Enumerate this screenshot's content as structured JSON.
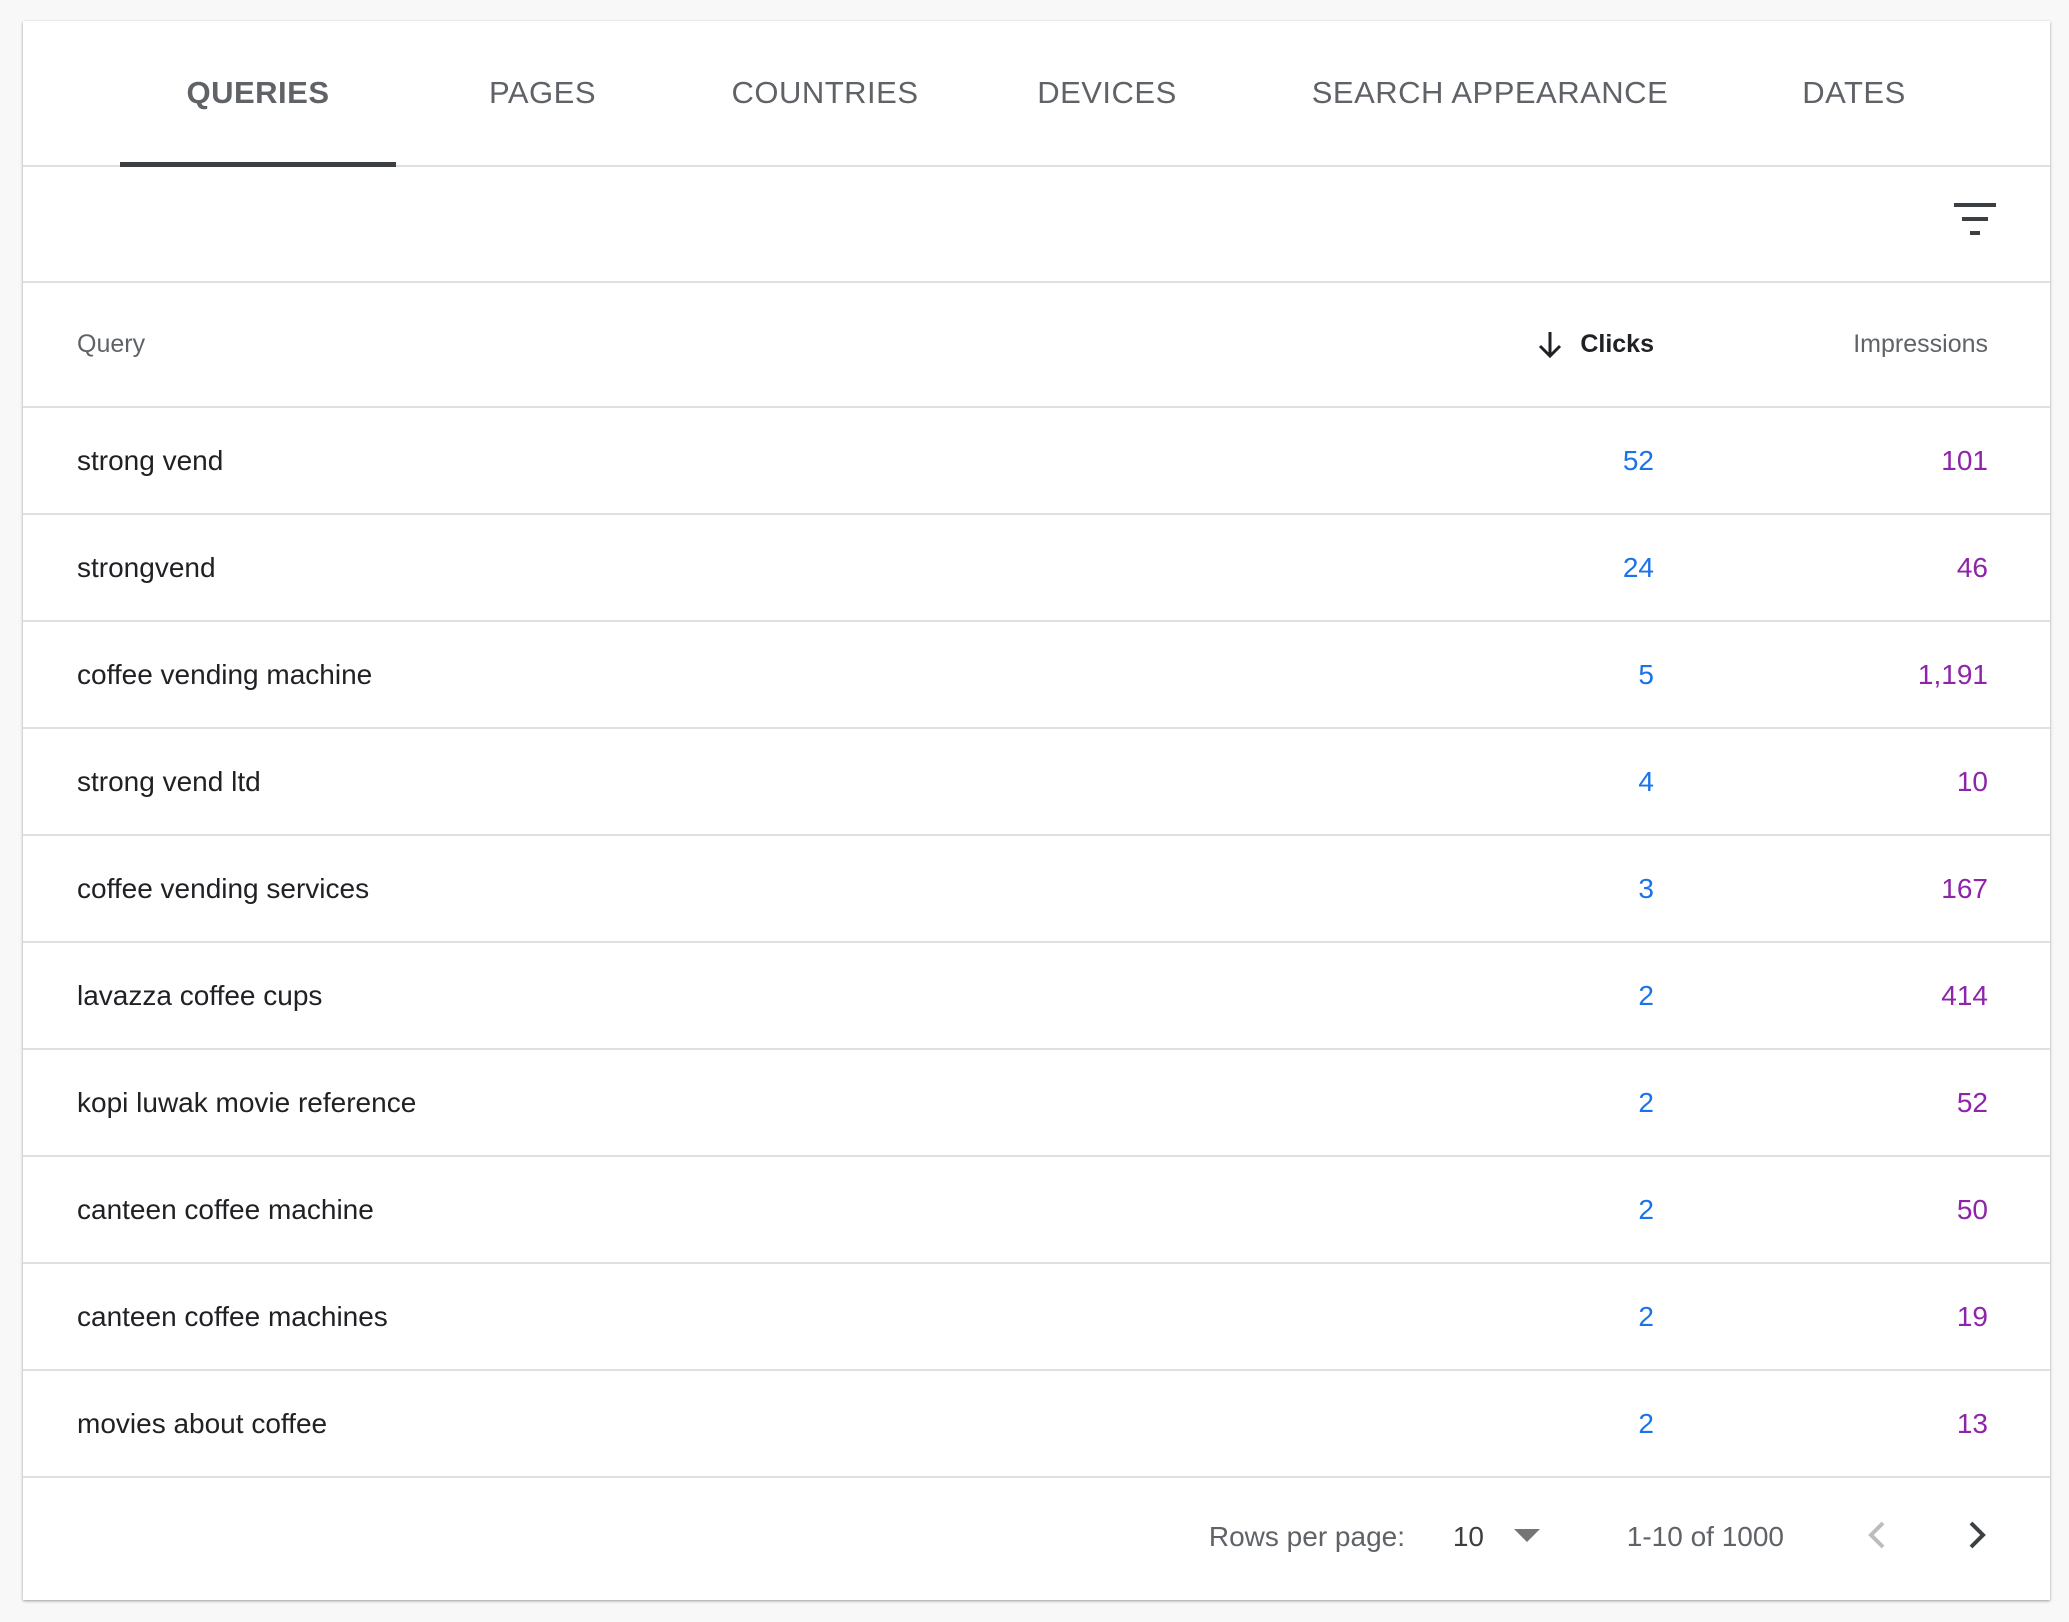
{
  "tabs": [
    {
      "label": "QUERIES",
      "active": true
    },
    {
      "label": "PAGES"
    },
    {
      "label": "COUNTRIES"
    },
    {
      "label": "DEVICES"
    },
    {
      "label": "SEARCH APPEARANCE"
    },
    {
      "label": "DATES"
    }
  ],
  "toolbar": {
    "filter_icon": "filter-icon"
  },
  "table": {
    "headers": {
      "query": "Query",
      "clicks": "Clicks",
      "impressions": "Impressions"
    },
    "sort_icon": "arrow-down-icon",
    "rows": [
      {
        "query": "strong vend",
        "clicks": "52",
        "impressions": "101"
      },
      {
        "query": "strongvend",
        "clicks": "24",
        "impressions": "46"
      },
      {
        "query": "coffee vending machine",
        "clicks": "5",
        "impressions": "1,191"
      },
      {
        "query": "strong vend ltd",
        "clicks": "4",
        "impressions": "10"
      },
      {
        "query": "coffee vending services",
        "clicks": "3",
        "impressions": "167"
      },
      {
        "query": "lavazza coffee cups",
        "clicks": "2",
        "impressions": "414"
      },
      {
        "query": "kopi luwak movie reference",
        "clicks": "2",
        "impressions": "52"
      },
      {
        "query": "canteen coffee machine",
        "clicks": "2",
        "impressions": "50"
      },
      {
        "query": "canteen coffee machines",
        "clicks": "2",
        "impressions": "19"
      },
      {
        "query": "movies about coffee",
        "clicks": "2",
        "impressions": "13"
      }
    ]
  },
  "pagination": {
    "rows_per_page_label": "Rows per page:",
    "rows_per_page_value": "10",
    "range": "1-10 of 1000"
  },
  "colors": {
    "clicks": "#1a73e8",
    "impressions": "#8e24aa",
    "active_tab_underline": "#3c4043"
  }
}
